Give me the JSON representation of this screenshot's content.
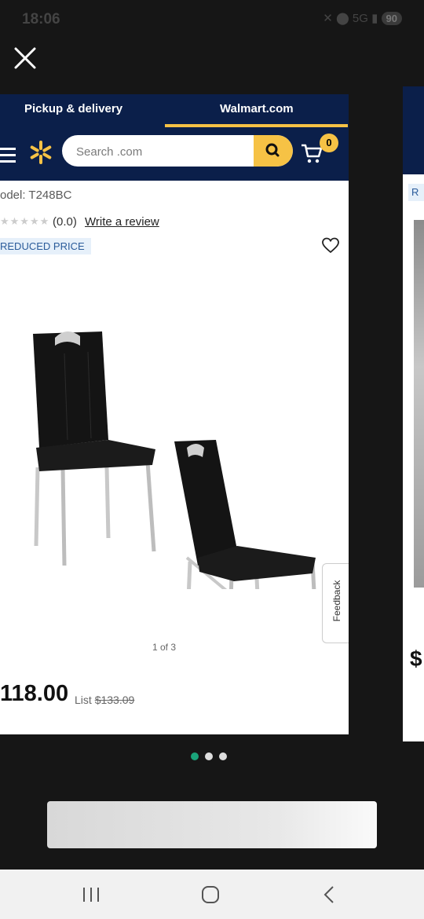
{
  "status_bar": {
    "time": "18:06",
    "network": "5G",
    "battery": "90"
  },
  "site": {
    "tabs": [
      {
        "label": "Pickup & delivery",
        "active": false
      },
      {
        "label": "Walmart.com",
        "active": true
      }
    ],
    "search": {
      "placeholder": "Search .com"
    },
    "cart_count": "0",
    "brand_color": "#0b1f4a",
    "accent_color": "#f6c245"
  },
  "product": {
    "model": "odel: T248BC",
    "rating": "(0.0)",
    "review_link": "Write a review",
    "badge": "REDUCED PRICE",
    "image_pager": "1 of 3",
    "price": "118.00",
    "list_label": "List",
    "list_price": "$133.09",
    "feedback_label": "Feedback"
  },
  "next_card": {
    "chip": "R",
    "price": "$"
  },
  "carousel": {
    "count": 3,
    "active": 0,
    "active_color": "#1aa37a"
  },
  "system_nav": {
    "icons": [
      "recents-icon",
      "home-icon",
      "back-icon"
    ]
  }
}
